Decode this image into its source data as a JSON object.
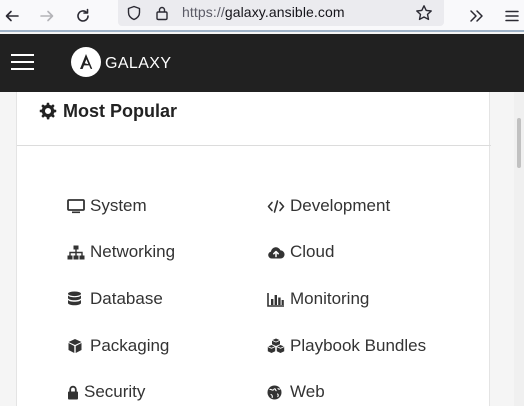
{
  "browser": {
    "url_prefix": "https://",
    "url_host": "galaxy.ansible.com"
  },
  "header": {
    "brand": "GALAXY"
  },
  "popular": {
    "title": "Most Popular",
    "categories": [
      {
        "label": "System",
        "icon": "desktop-icon"
      },
      {
        "label": "Development",
        "icon": "code-icon"
      },
      {
        "label": "Networking",
        "icon": "sitemap-icon"
      },
      {
        "label": "Cloud",
        "icon": "cloud-upload-icon"
      },
      {
        "label": "Database",
        "icon": "database-icon"
      },
      {
        "label": "Monitoring",
        "icon": "bar-chart-icon"
      },
      {
        "label": "Packaging",
        "icon": "cube-icon"
      },
      {
        "label": "Playbook Bundles",
        "icon": "cubes-icon"
      },
      {
        "label": "Security",
        "icon": "lock-icon"
      },
      {
        "label": "Web",
        "icon": "globe-icon"
      }
    ]
  }
}
